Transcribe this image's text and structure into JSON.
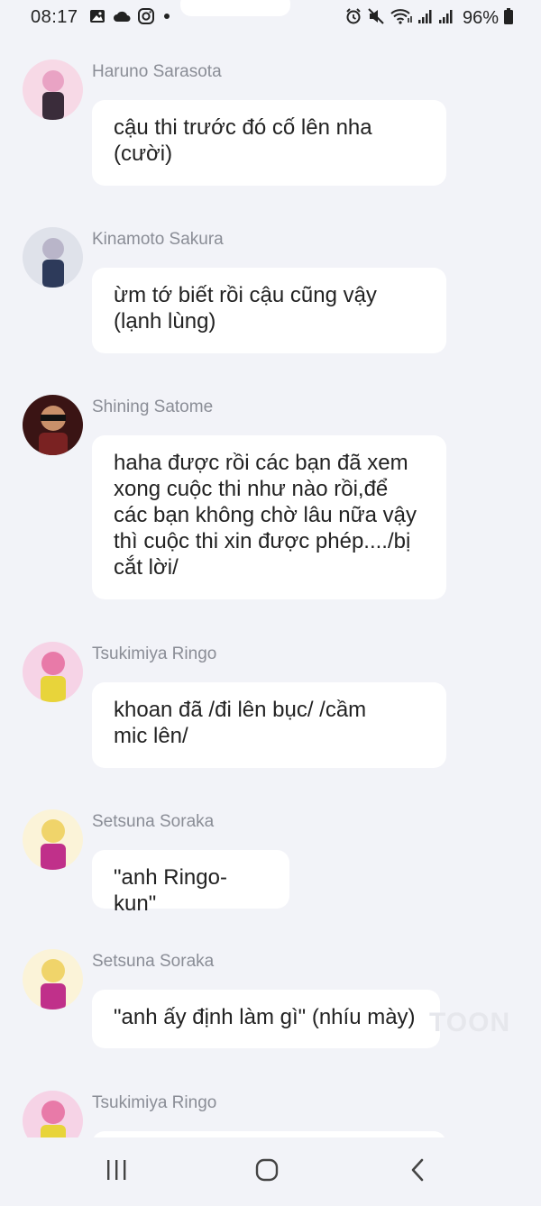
{
  "status_bar": {
    "time": "08:17",
    "battery_percent": "96%",
    "icons_left": [
      "gallery-icon",
      "cloud-icon",
      "instagram-icon",
      "dot-icon"
    ],
    "icons_right": [
      "alarm-icon",
      "mute-icon",
      "wifi-icon",
      "signal-icon",
      "signal-icon",
      "battery-icon"
    ]
  },
  "messages": [
    {
      "sender": "Haruno Sarasota",
      "text": "cậu thi trước đó cố lên nha\n(cười)",
      "avatar_colors": [
        "#f7d9e6",
        "#e9a3c4",
        "#3a2c3a"
      ]
    },
    {
      "sender": "Kinamoto Sakura",
      "text": "ừm tớ biết rồi cậu cũng vậy\n(lạnh lùng)",
      "avatar_colors": [
        "#dfe2ea",
        "#b9b5c9",
        "#2d3a5a"
      ]
    },
    {
      "sender": "Shining Satome",
      "text": "haha được rồi các bạn đã xem\nxong cuộc thi như nào rồi,để\ncác bạn không chờ lâu nữa vậy\nthì cuộc thi xin được phép..../bị\ncắt lời/",
      "avatar_colors": [
        "#3a1414",
        "#7a2222",
        "#c9906a"
      ]
    },
    {
      "sender": "Tsukimiya Ringo",
      "text": "khoan đã /đi lên bục/ /cầm\nmic lên/",
      "avatar_colors": [
        "#f6d3e6",
        "#e87aa8",
        "#e8d43a"
      ]
    },
    {
      "sender": "Setsuna Soraka",
      "text": "\"anh Ringo-kun\"",
      "avatar_colors": [
        "#fbf3d8",
        "#f0d46a",
        "#c0308a"
      ]
    },
    {
      "sender": "Setsuna Soraka",
      "text": "\"anh ấy định làm gì\" (nhíu mày)",
      "avatar_colors": [
        "#fbf3d8",
        "#f0d46a",
        "#c0308a"
      ]
    },
    {
      "sender": "Tsukimiya Ringo",
      "text": "",
      "avatar_colors": [
        "#f6d3e6",
        "#e87aa8",
        "#e8d43a"
      ]
    }
  ],
  "watermark": "TOON",
  "nav_bar": {
    "buttons": [
      "recent-apps",
      "home",
      "back"
    ]
  }
}
